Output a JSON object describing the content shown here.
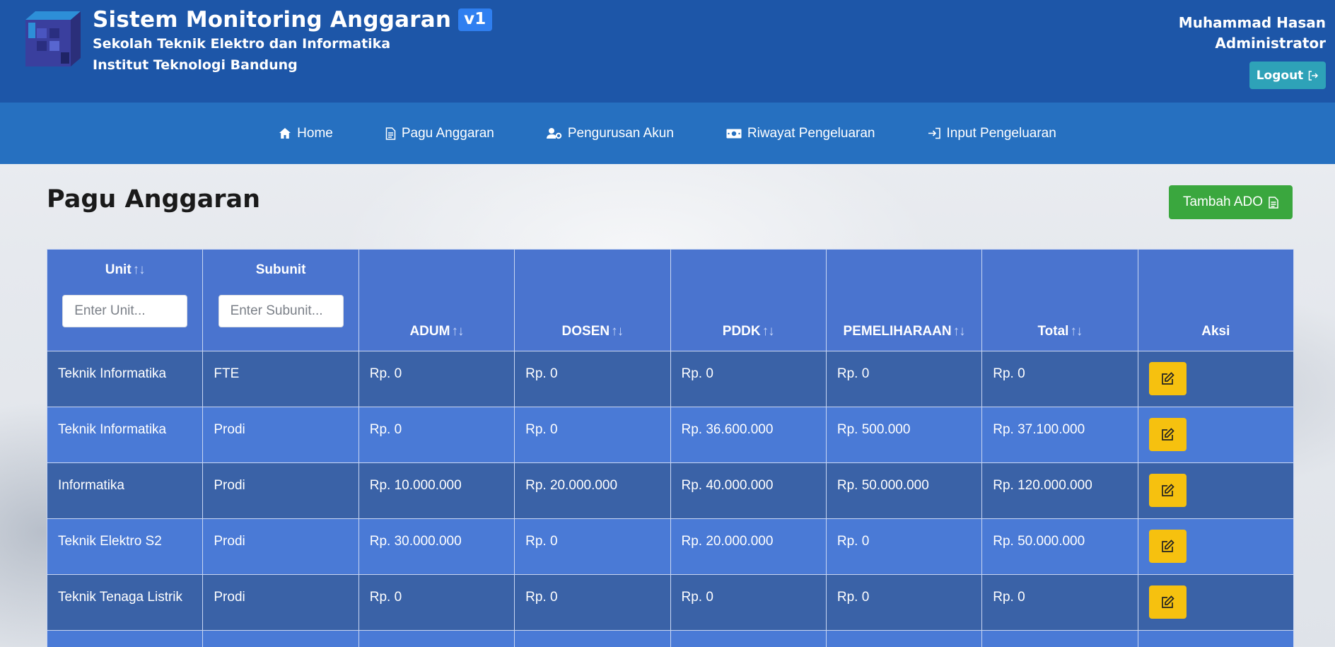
{
  "header": {
    "title": "Sistem Monitoring Anggaran",
    "version_badge": "v1",
    "subtitle_line1": "Sekolah Teknik Elektro dan Informatika",
    "subtitle_line2": "Institut Teknologi Bandung",
    "user_name": "Muhammad Hasan",
    "user_role": "Administrator",
    "logout_label": "Logout"
  },
  "nav": {
    "items": [
      {
        "label": "Home",
        "icon": "home-icon"
      },
      {
        "label": "Pagu Anggaran",
        "icon": "document-icon"
      },
      {
        "label": "Pengurusan Akun",
        "icon": "user-gear-icon"
      },
      {
        "label": "Riwayat Pengeluaran",
        "icon": "money-icon"
      },
      {
        "label": "Input Pengeluaran",
        "icon": "sign-in-icon"
      }
    ]
  },
  "page": {
    "title": "Pagu Anggaran",
    "add_button_label": "Tambah ADO"
  },
  "table": {
    "columns": [
      "Unit",
      "Subunit",
      "ADUM",
      "DOSEN",
      "PDDK",
      "PEMELIHARAAN",
      "Total",
      "Aksi"
    ],
    "sort_glyph": "↑↓",
    "filters": {
      "unit_placeholder": "Enter Unit...",
      "subunit_placeholder": "Enter Subunit..."
    },
    "rows": [
      {
        "unit": "Teknik Informatika",
        "subunit": "FTE",
        "adum": "Rp. 0",
        "dosen": "Rp. 0",
        "pddk": "Rp. 0",
        "pemeliharaan": "Rp. 0",
        "total": "Rp. 0"
      },
      {
        "unit": "Teknik Informatika",
        "subunit": "Prodi",
        "adum": "Rp. 0",
        "dosen": "Rp. 0",
        "pddk": "Rp. 36.600.000",
        "pemeliharaan": "Rp. 500.000",
        "total": "Rp. 37.100.000"
      },
      {
        "unit": "Informatika",
        "subunit": "Prodi",
        "adum": "Rp. 10.000.000",
        "dosen": "Rp. 20.000.000",
        "pddk": "Rp. 40.000.000",
        "pemeliharaan": "Rp. 50.000.000",
        "total": "Rp. 120.000.000"
      },
      {
        "unit": "Teknik Elektro S2",
        "subunit": "Prodi",
        "adum": "Rp. 30.000.000",
        "dosen": "Rp. 0",
        "pddk": "Rp. 20.000.000",
        "pemeliharaan": "Rp. 0",
        "total": "Rp. 50.000.000"
      },
      {
        "unit": "Teknik Tenaga Listrik",
        "subunit": "Prodi",
        "adum": "Rp. 0",
        "dosen": "Rp. 0",
        "pddk": "Rp. 0",
        "pemeliharaan": "Rp. 0",
        "total": "Rp. 0"
      }
    ]
  },
  "colors": {
    "header_bg": "#1d56a8",
    "navbar_bg": "#2670c0",
    "table_header_bg": "#4a74cf",
    "row_dark": "#3a62a7",
    "row_light": "#4a7ad6",
    "edit_button": "#f6c10f",
    "add_button": "#3aa73e",
    "logout_button": "#2ea2b8"
  }
}
